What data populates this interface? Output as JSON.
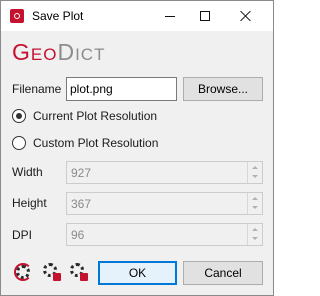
{
  "window": {
    "title": "Save Plot"
  },
  "logo": {
    "part1_big": "G",
    "part1_small": "EO",
    "part2_big": "D",
    "part2_small": "ICT"
  },
  "filename": {
    "label": "Filename",
    "value": "plot.png",
    "browse_label": "Browse..."
  },
  "resolution": {
    "current_label": "Current Plot Resolution",
    "custom_label": "Custom Plot Resolution",
    "selected": "current"
  },
  "fields": {
    "width_label": "Width",
    "width_value": "927",
    "height_label": "Height",
    "height_value": "367",
    "dpi_label": "DPI",
    "dpi_value": "96"
  },
  "footer": {
    "ok_label": "OK",
    "cancel_label": "Cancel",
    "tool_icons": [
      "reset-settings-icon",
      "save-settings-icon",
      "delete-settings-icon"
    ]
  },
  "colors": {
    "brand_red": "#c4122f",
    "brand_gray": "#8c8c8c",
    "focus_blue": "#0078d7"
  }
}
